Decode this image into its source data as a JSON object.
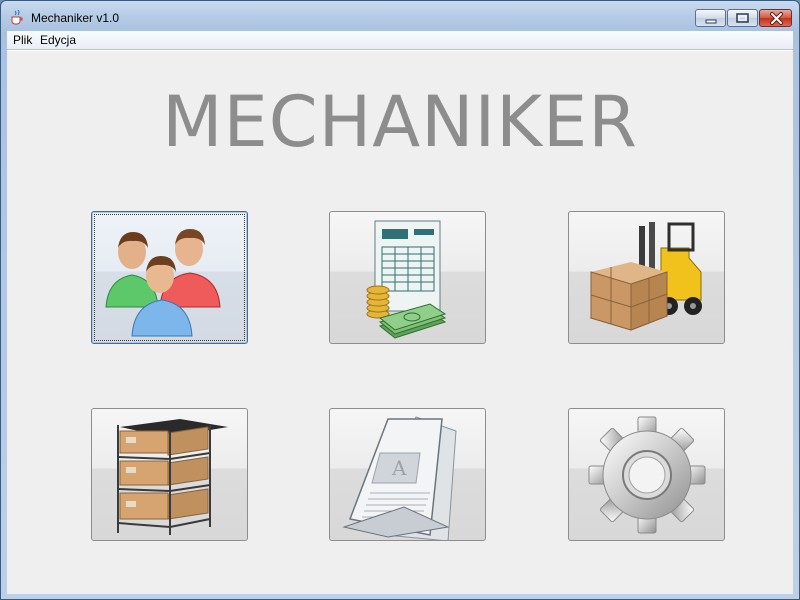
{
  "window": {
    "title": "Mechaniker v1.0",
    "icon": "java-cup-icon"
  },
  "title_buttons": {
    "minimize": "minimize-icon",
    "maximize": "maximize-icon",
    "close": "close-icon"
  },
  "menubar": {
    "items": [
      "Plik",
      "Edycja"
    ]
  },
  "main": {
    "heading": "MECHANIKER",
    "tiles": [
      {
        "icon": "users-icon",
        "focused": true
      },
      {
        "icon": "invoice-money-icon",
        "focused": false
      },
      {
        "icon": "forklift-icon",
        "focused": false
      },
      {
        "icon": "warehouse-shelves-icon",
        "focused": false
      },
      {
        "icon": "documents-icon",
        "focused": false
      },
      {
        "icon": "settings-gear-icon",
        "focused": false
      }
    ]
  },
  "colors": {
    "heading": "#8d8d8d",
    "content_bg": "#efefef",
    "close_button": "#c1321c"
  }
}
